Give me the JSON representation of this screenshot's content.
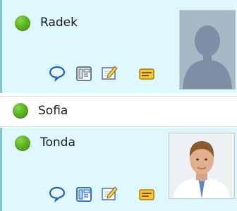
{
  "contacts": [
    {
      "name": "Radek",
      "presence": "online",
      "expanded": true,
      "photo": "placeholder-silhouette",
      "actions": [
        "chat-bubble-icon",
        "phone-icon",
        "edit-note-icon",
        "contact-card-icon"
      ]
    },
    {
      "name": "Sofia",
      "presence": "online",
      "expanded": false
    },
    {
      "name": "Tonda",
      "presence": "online",
      "expanded": true,
      "photo": "user-photo",
      "actions": [
        "chat-bubble-icon",
        "phone-icon",
        "edit-note-icon",
        "contact-card-icon"
      ]
    }
  ],
  "colors": {
    "expanded_row_bg": "#dff8fd",
    "row_border": "#86c6d3",
    "presence_online": "#5cb41f"
  }
}
